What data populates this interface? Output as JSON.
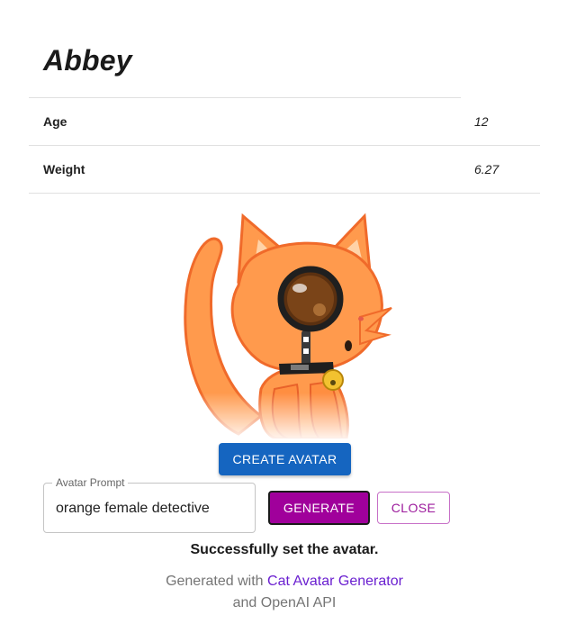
{
  "cat": {
    "name": "Abbey",
    "fields": [
      {
        "label": "Age",
        "value": "12"
      },
      {
        "label": "Weight",
        "value": "6.27"
      }
    ]
  },
  "avatar": {
    "icon": "cat-avatar-image",
    "description": "orange cartoon cat with magnifying glass and bell collar"
  },
  "actions": {
    "create_label": "CREATE AVATAR",
    "generate_label": "GENERATE",
    "close_label": "CLOSE"
  },
  "prompt": {
    "label": "Avatar Prompt",
    "value": "orange female detective"
  },
  "status": "Successfully set the avatar.",
  "footer": {
    "prefix": "Generated with ",
    "link_text": "Cat Avatar Generator",
    "suffix": "and OpenAI API"
  },
  "colors": {
    "create_button": "#1565c0",
    "generate_button": "#a0009b",
    "close_button_text": "#9c1a9c",
    "link": "#6a1fd0",
    "cat_orange": "#ff9a4d"
  }
}
